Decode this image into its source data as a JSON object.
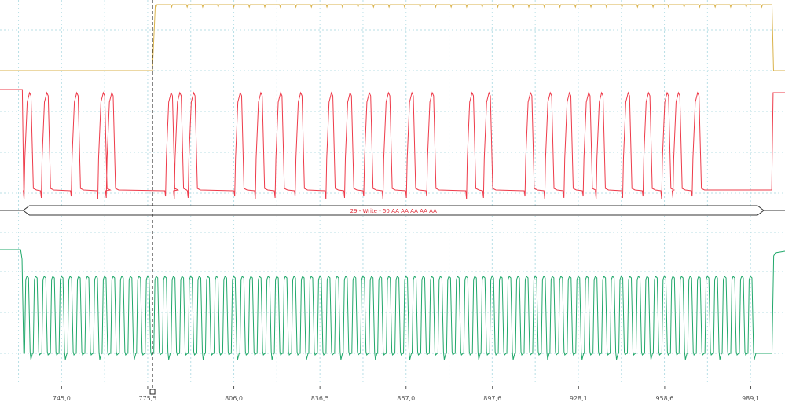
{
  "colors": {
    "background": "#ffffff",
    "grid": "#b8dfe6",
    "channel_top": "#d9b24a",
    "channel_mid": "#ee3b4a",
    "channel_bottom": "#21a86b",
    "decode_outline": "#333333",
    "decode_text": "#e0303c",
    "axis_text": "#555555",
    "cursor": "#222222"
  },
  "chart_data": {
    "type": "line",
    "title": "",
    "xlabel": "",
    "ylabel": "",
    "x_ticks": [
      "745,0",
      "775,5",
      "806,0",
      "836,5",
      "867,0",
      "897,6",
      "928,1",
      "958,6",
      "989,1"
    ],
    "x_tick_values": [
      745.0,
      775.5,
      806.0,
      836.5,
      867.0,
      897.6,
      928.1,
      958.6,
      989.1
    ],
    "xlim": [
      723.2,
      1001.2
    ],
    "grid": true,
    "cursor_x": 777.2,
    "series": [
      {
        "name": "",
        "role": "select",
        "color_key": "channel_top",
        "low_before": 777.2,
        "high_from": 778.2,
        "high_until": 996.6
      },
      {
        "name": "",
        "role": "data",
        "color_key": "channel_mid",
        "pulse_starts": [
          732.0,
          738.1,
          748.7,
          758.1,
          761.1,
          782.1,
          785.2,
          790.1,
          806.6,
          813.9,
          820.9,
          828.0,
          838.9,
          845.5,
          852.3,
          859.1,
          867.4,
          874.6,
          888.7,
          894.7,
          909.4,
          916.4,
          923.2,
          930.0,
          934.6,
          944.0,
          951.2,
          957.8,
          961.8,
          968.6
        ],
        "pulse_width": 3.0
      },
      {
        "name": "",
        "role": "clock",
        "color_key": "channel_bottom",
        "first_pulse": 731.9,
        "period": 3.05,
        "pulse_count": 85,
        "duty": 0.55
      }
    ]
  },
  "decode": {
    "label": "29 - Write - 50 AA AA AA AA AA"
  }
}
